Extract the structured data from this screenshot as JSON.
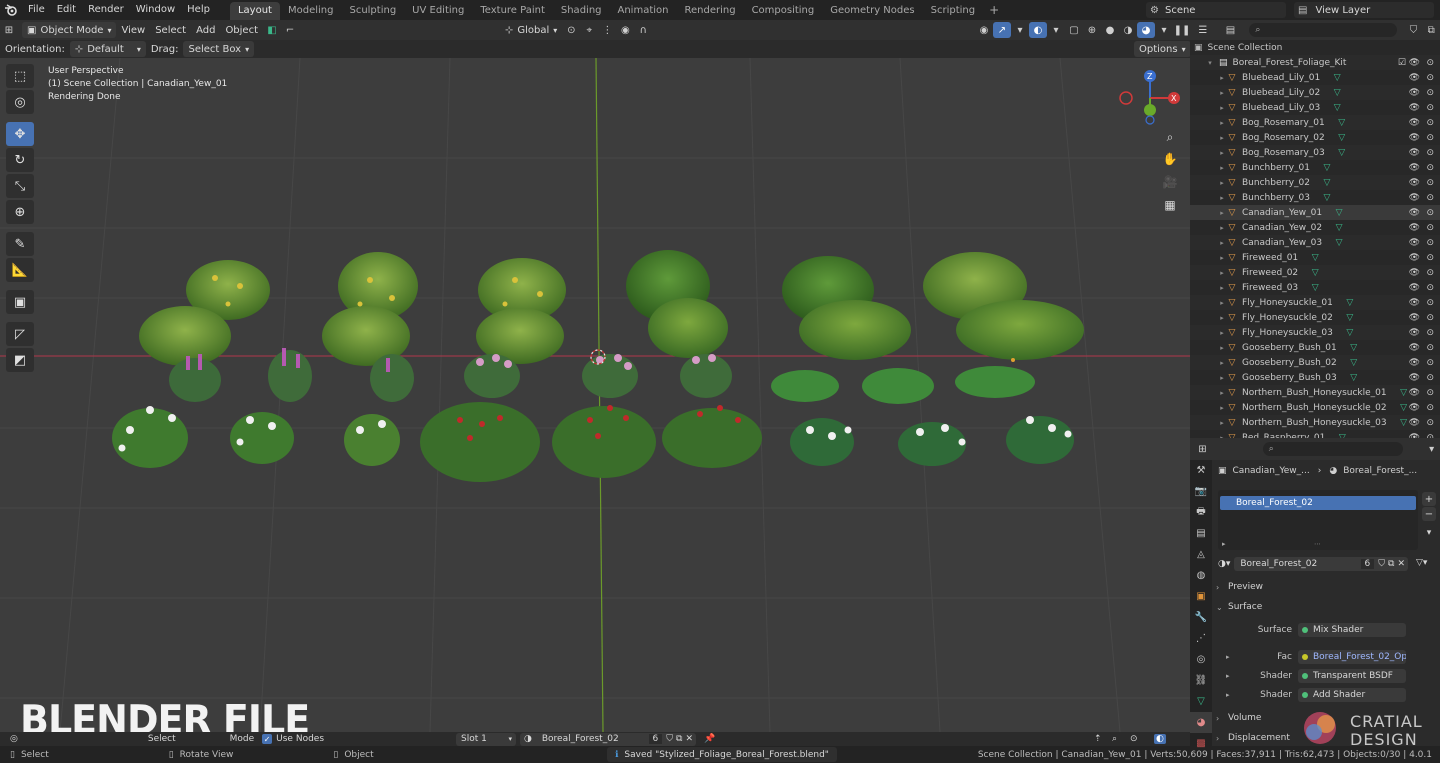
{
  "menu": {
    "items": [
      "File",
      "Edit",
      "Render",
      "Window",
      "Help"
    ],
    "workspaces": [
      "Layout",
      "Modeling",
      "Sculpting",
      "UV Editing",
      "Texture Paint",
      "Shading",
      "Animation",
      "Rendering",
      "Compositing",
      "Geometry Nodes",
      "Scripting"
    ],
    "active_workspace": "Layout",
    "scene": "Scene",
    "view_layer": "View Layer"
  },
  "viewport_header": {
    "mode": "Object Mode",
    "menus": [
      "View",
      "Select",
      "Add",
      "Object"
    ],
    "transform_orientation": "Global",
    "orientation_label": "Orientation:",
    "orientation_value": "Default",
    "drag_label": "Drag:",
    "drag_value": "Select Box",
    "options": "Options"
  },
  "viewport": {
    "perspective": "User Perspective",
    "collection_line": "(1) Scene Collection | Canadian_Yew_01",
    "render_status": "Rendering Done",
    "watermark": "BLENDER FILE"
  },
  "viewport_footer": {
    "select": "Select",
    "mode": "Mode",
    "use_nodes": "Use Nodes",
    "slot": "Slot 1",
    "material": "Boreal_Forest_02",
    "users": "6"
  },
  "statusbar": {
    "select": "Select",
    "rotate": "Rotate View",
    "object": "Object",
    "saved": "Saved \"Stylized_Foliage_Boreal_Forest.blend\"",
    "stats": "Scene Collection | Canadian_Yew_01 | Verts:50,609 | Faces:37,911 | Tris:62,473 | Objects:0/30 | 4.0.1"
  },
  "outliner": {
    "root": "Scene Collection",
    "collection": "Boreal_Forest_Foliage_Kit",
    "objects": [
      "Bluebead_Lily_01",
      "Bluebead_Lily_02",
      "Bluebead_Lily_03",
      "Bog_Rosemary_01",
      "Bog_Rosemary_02",
      "Bog_Rosemary_03",
      "Bunchberry_01",
      "Bunchberry_02",
      "Bunchberry_03",
      "Canadian_Yew_01",
      "Canadian_Yew_02",
      "Canadian_Yew_03",
      "Fireweed_01",
      "Fireweed_02",
      "Fireweed_03",
      "Fly_Honeysuckle_01",
      "Fly_Honeysuckle_02",
      "Fly_Honeysuckle_03",
      "Gooseberry_Bush_01",
      "Gooseberry_Bush_02",
      "Gooseberry_Bush_03",
      "Northern_Bush_Honeysuckle_01",
      "Northern_Bush_Honeysuckle_02",
      "Northern_Bush_Honeysuckle_03",
      "Red_Raspberry_01"
    ]
  },
  "properties": {
    "breadcrumb_object": "Canadian_Yew_...",
    "breadcrumb_material": "Boreal_Forest_...",
    "slot_material": "Boreal_Forest_02",
    "material_name": "Boreal_Forest_02",
    "material_users": "6",
    "sections": {
      "preview": "Preview",
      "surface": "Surface",
      "volume": "Volume",
      "displacement": "Displacement"
    },
    "rows": [
      {
        "label": "Surface",
        "value": "Mix Shader"
      },
      {
        "label": "Fac",
        "value": "Boreal_Forest_02_Opa..."
      },
      {
        "label": "Shader",
        "value": "Transparent BSDF"
      },
      {
        "label": "Shader",
        "value": "Add Shader"
      }
    ]
  },
  "brand": {
    "line1": "CRATIAL",
    "line2": "DESIGN"
  }
}
